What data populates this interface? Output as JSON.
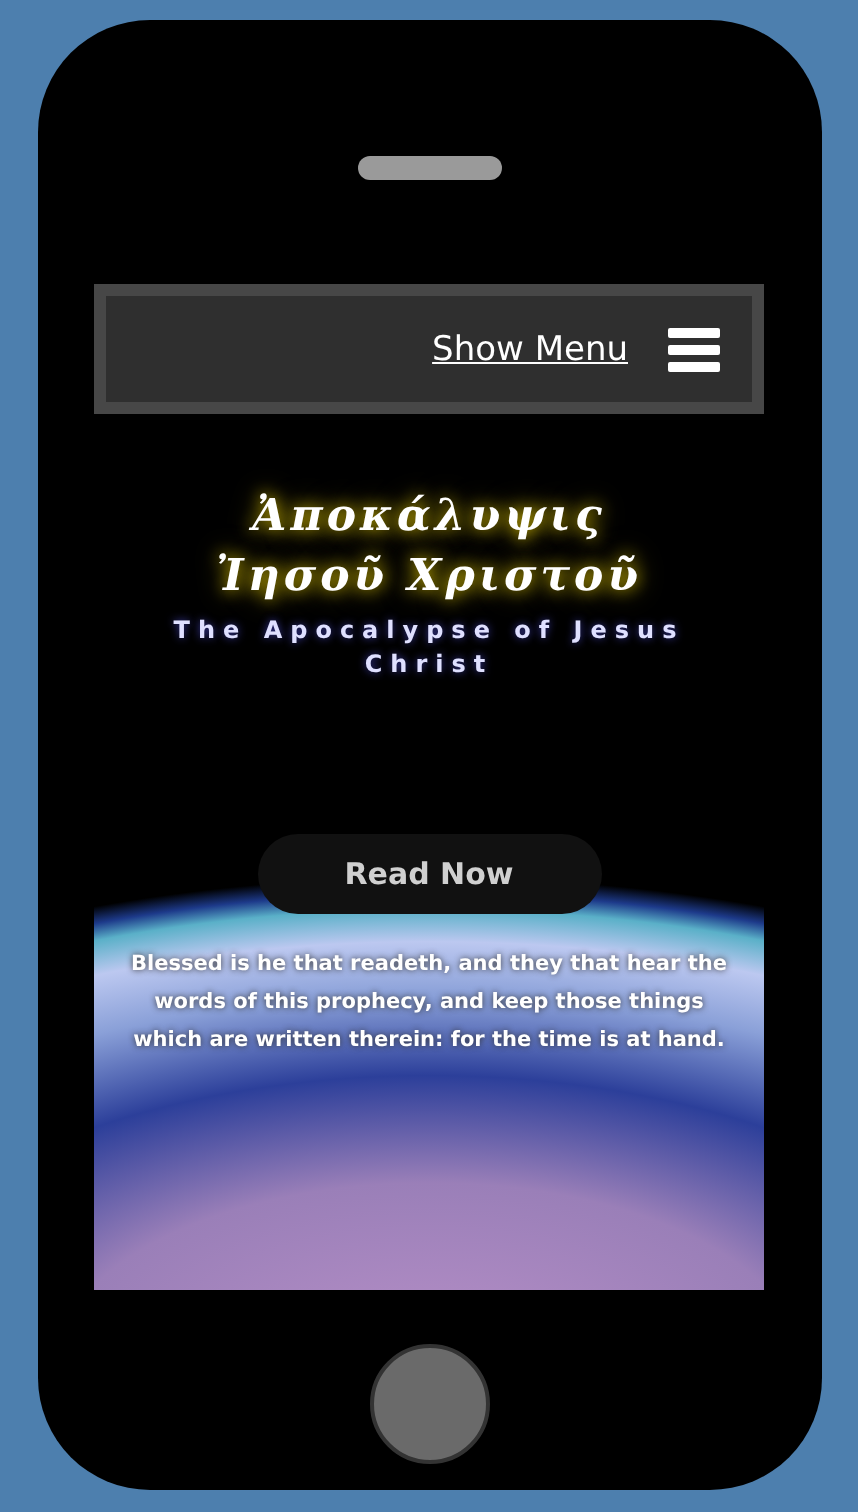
{
  "nav": {
    "link": "Show Menu"
  },
  "hero": {
    "title": "Ἀποκάλυψις Ἰησοῦ Χριστοῦ",
    "subtitle": "The Apocalypse of Jesus Christ"
  },
  "banner": {
    "button": "Read Now",
    "quote": "Blessed is he that readeth, and they that hear the words of this prophecy, and keep those things which are written therein: for the time is at hand."
  }
}
